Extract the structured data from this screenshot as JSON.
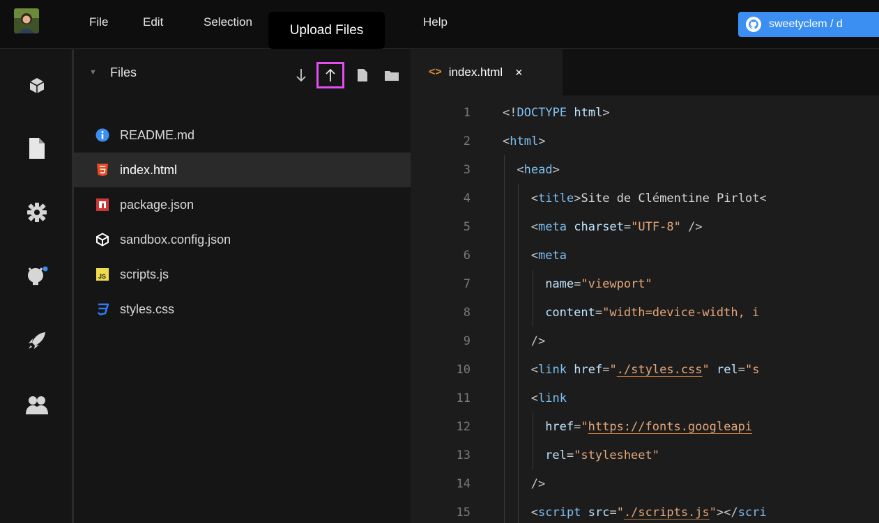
{
  "menubar": {
    "items": [
      "File",
      "Edit",
      "Selection",
      "Help"
    ],
    "github_button": "sweetyclem / d"
  },
  "tooltip": {
    "text": "Upload Files"
  },
  "activity_bar": {
    "icons": [
      "cube-icon",
      "file-icon",
      "gear-icon",
      "github-icon",
      "rocket-icon",
      "users-icon"
    ]
  },
  "explorer": {
    "title": "Files",
    "actions": [
      "download-icon",
      "upload-icon",
      "new-file-icon",
      "new-folder-icon"
    ],
    "files": [
      {
        "name": "README.md",
        "icon": "info-icon",
        "color": "#3b8ff2"
      },
      {
        "name": "index.html",
        "icon": "html5-icon",
        "color": "#e44d26",
        "active": true
      },
      {
        "name": "package.json",
        "icon": "npm-icon",
        "color": "#cb3837"
      },
      {
        "name": "sandbox.config.json",
        "icon": "codesandbox-icon",
        "color": "#ffffff"
      },
      {
        "name": "scripts.js",
        "icon": "js-icon",
        "color": "#f0db4f"
      },
      {
        "name": "styles.css",
        "icon": "css3-icon",
        "color": "#2965f1"
      }
    ]
  },
  "editor": {
    "tab": {
      "label": "index.html",
      "close": "×"
    },
    "lines": [
      {
        "n": "1",
        "text": "<!DOCTYPE html>"
      },
      {
        "n": "2",
        "text": "<html>"
      },
      {
        "n": "3",
        "text": "<head>"
      },
      {
        "n": "4",
        "text": "<title>Site de Clémentine Pirlot<"
      },
      {
        "n": "5",
        "text": "<meta charset=\"UTF-8\" />"
      },
      {
        "n": "6",
        "text": "<meta"
      },
      {
        "n": "7",
        "text": "name=\"viewport\""
      },
      {
        "n": "8",
        "text": "content=\"width=device-width, in"
      },
      {
        "n": "9",
        "text": "/>"
      },
      {
        "n": "10",
        "text": "<link href=\"./styles.css\" rel=\"st"
      },
      {
        "n": "11",
        "text": "<link"
      },
      {
        "n": "12",
        "text": "href=\"https://fonts.googleapis"
      },
      {
        "n": "13",
        "text": "rel=\"stylesheet\""
      },
      {
        "n": "14",
        "text": "/>"
      },
      {
        "n": "15",
        "text": "<script src=\"./scripts.js\"></scri"
      }
    ]
  },
  "colors": {
    "accent_blue": "#3b8ff2",
    "highlight_magenta": "#e24ef0"
  }
}
